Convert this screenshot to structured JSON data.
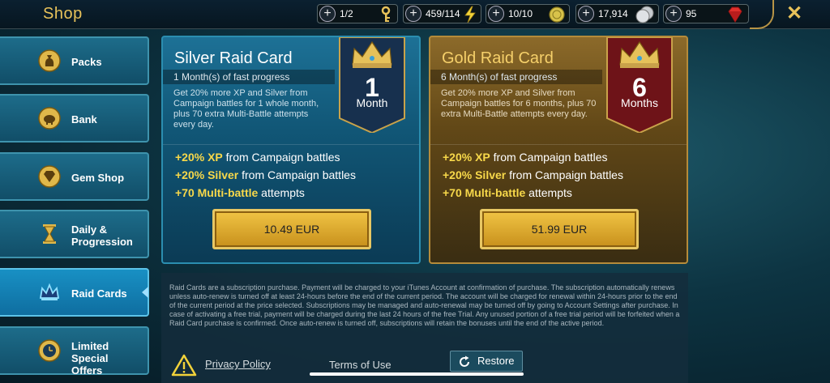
{
  "header": {
    "title": "Shop",
    "close_icon": "close-icon",
    "resources": [
      {
        "name": "keys",
        "value": "1/2",
        "icon": "key-icon",
        "color": "#e8c25a"
      },
      {
        "name": "energy",
        "value": "459/114",
        "icon": "lightning-icon",
        "color": "#f4d63a"
      },
      {
        "name": "arena-tokens",
        "value": "10/10",
        "icon": "gold-coin-icon",
        "color": "#d8c24a"
      },
      {
        "name": "silver",
        "value": "17,914",
        "icon": "silver-coin-icon",
        "color": "#c8ccd0"
      },
      {
        "name": "gems",
        "value": "95",
        "icon": "ruby-icon",
        "color": "#e0302c"
      }
    ]
  },
  "sidebar": {
    "items": [
      {
        "label": "Packs",
        "icon": "money-bag-icon"
      },
      {
        "label": "Bank",
        "icon": "piggy-bank-icon"
      },
      {
        "label": "Gem Shop",
        "icon": "gem-icon"
      },
      {
        "label_line1": "Daily &",
        "label_line2": "Progression",
        "icon": "hourglass-icon"
      },
      {
        "label": "Raid Cards",
        "icon": "crown-icon",
        "active": true
      },
      {
        "label_line1": "Limited Special",
        "label_line2": "Offers",
        "icon": "clock-medal-icon"
      }
    ]
  },
  "cards": {
    "silver": {
      "title": "Silver Raid Card",
      "subtitle": "1 Month(s) of fast progress",
      "description": "Get 20% more XP and Silver from Campaign battles for 1 whole month, plus 70 extra Multi-Battle attempts every day.",
      "banner_number": "1",
      "banner_unit": "Month",
      "banner_color": "#17304e",
      "benefits": [
        {
          "hl": "+20% XP",
          "rest": " from Campaign battles"
        },
        {
          "hl": "+20% Silver",
          "rest": " from Campaign battles"
        },
        {
          "hl": "+70 Multi-battle",
          "rest": " attempts"
        }
      ],
      "price": "10.49 EUR"
    },
    "gold": {
      "title": "Gold Raid Card",
      "subtitle": "6 Month(s) of fast progress",
      "description": "Get 20% more XP and Silver from Campaign battles for 6 months, plus 70 extra Multi-Battle attempts every day.",
      "banner_number": "6",
      "banner_unit": "Months",
      "banner_color": "#6e1318",
      "benefits": [
        {
          "hl": "+20% XP",
          "rest": " from Campaign battles"
        },
        {
          "hl": "+20% Silver",
          "rest": " from Campaign battles"
        },
        {
          "hl": "+70 Multi-battle",
          "rest": " attempts"
        }
      ],
      "price": "51.99 EUR"
    }
  },
  "terms": {
    "text": "Raid Cards are a subscription purchase. Payment will be charged to your iTunes Account at confirmation of purchase. The subscription automatically renews unless auto-renew is turned off at least 24-hours before the end of the current period. The account will be charged for renewal within 24-hours prior to the end of the current period at the price selected. Subscriptions may be managed and auto-renewal may be turned off by going to Account Settings after purchase. In case of activating a free trial, payment will be charged during the last 24 hours of the free Trial. Any unused portion of a free trial period will be forfeited when a Raid Card purchase is confirmed. Once auto-renew is turned off, subscriptions will retain the bonuses until the end of the active period.",
    "privacy_label": "Privacy Policy",
    "terms_label": "Terms of Use",
    "restore_label": "Restore",
    "warning_icon": "warning-icon"
  }
}
